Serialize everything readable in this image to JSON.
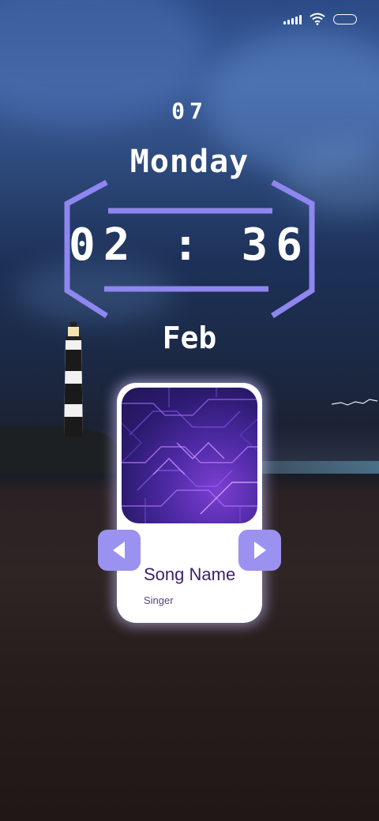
{
  "status_bar": {
    "signal_icon": "signal-bars-icon",
    "wifi_icon": "wifi-icon",
    "battery_icon": "battery-icon"
  },
  "clock": {
    "day_number": "07",
    "weekday": "Monday",
    "time": "02 : 36",
    "month": "Feb",
    "frame_color": "#8f86f0"
  },
  "player": {
    "song_name": "Song Name",
    "singer": "Singer",
    "prev_icon": "triangle-left-icon",
    "next_icon": "triangle-right-icon",
    "button_color": "#9b91f0",
    "title_color": "#3d1f6a"
  }
}
